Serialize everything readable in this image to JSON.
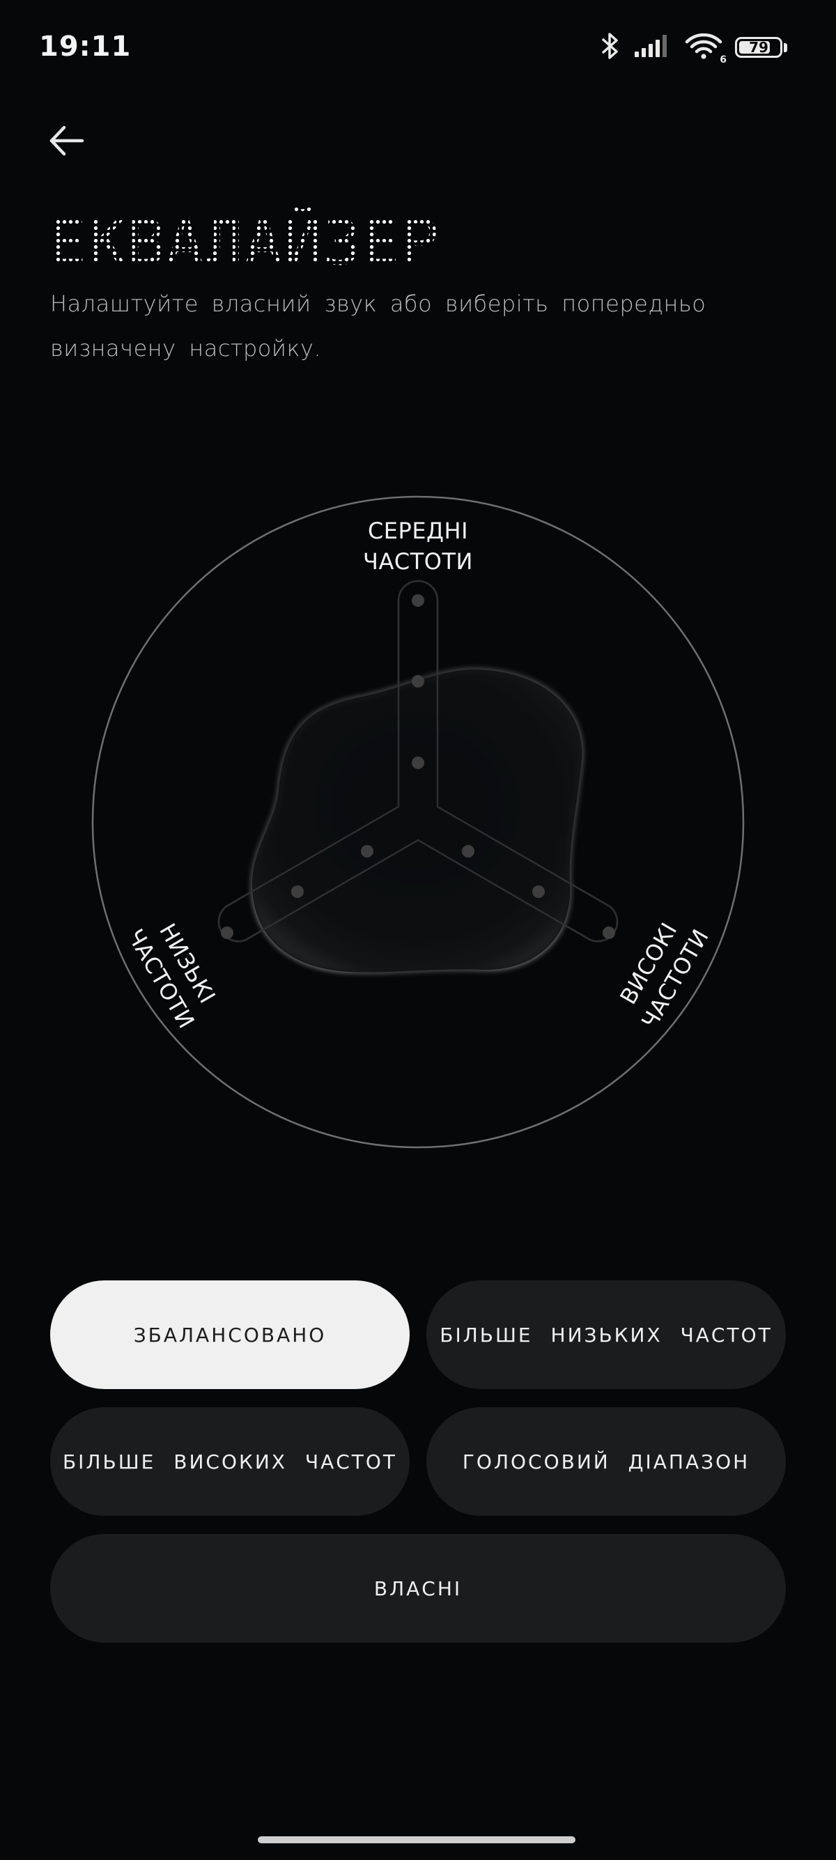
{
  "status_bar": {
    "time": "19:11",
    "battery_level": "79",
    "battery_fraction": 0.79,
    "icons": [
      "bluetooth-icon",
      "signal-icon",
      "wifi-icon",
      "battery-icon"
    ],
    "signal_sub": "6"
  },
  "header": {
    "back_icon": "arrow-left-icon",
    "title": "ЕКВАЛАЙЗЕР",
    "subtitle": "Налаштуйте власний звук або виберіть попередньо визначену настройку."
  },
  "equalizer": {
    "mid_label": "СЕРЕДНІ\nЧАСТОТИ",
    "low_label": "НИЗЬКІ\nЧАСТОТИ",
    "high_label": "ВИСОКІ\nЧАСТОТИ",
    "ring_color": "#6f6f6f",
    "track_color": "#3a3a3a"
  },
  "presets": {
    "balanced": "ЗБАЛАНСОВАНО",
    "more_bass": "БІЛЬШЕ НИЗЬКИХ ЧАСТОТ",
    "more_treble": "БІЛЬШЕ ВИСОКИХ ЧАСТОТ",
    "voice": "ГОЛОСОВИЙ ДІАПАЗОН",
    "custom": "ВЛАСНІ",
    "selected": "balanced",
    "active_color": "#eff0ef",
    "inactive_color": "#1b1c1e"
  }
}
